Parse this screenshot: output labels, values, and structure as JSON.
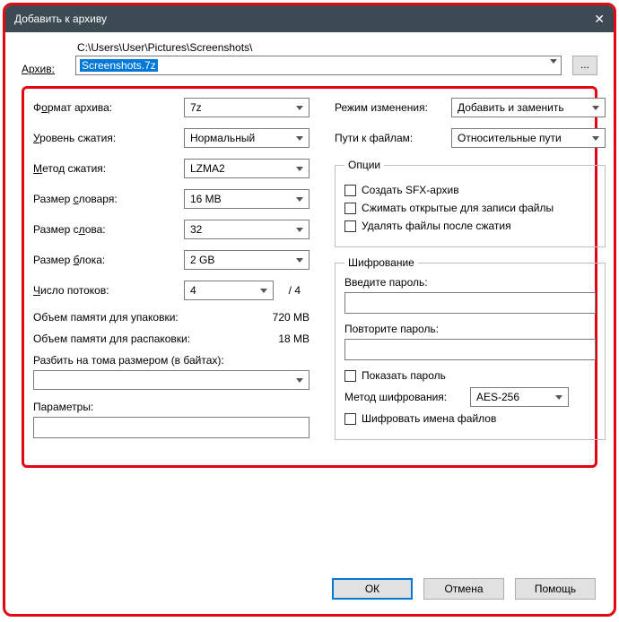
{
  "title": "Добавить к архиву",
  "archive": {
    "label": "Архив:",
    "path": "C:\\Users\\User\\Pictures\\Screenshots\\",
    "filename": "Screenshots.7z",
    "browse": "..."
  },
  "left": {
    "format": {
      "label_pre": "Ф",
      "label_u": "о",
      "label_post": "рмат архива:",
      "value": "7z"
    },
    "level": {
      "label_pre": "",
      "label_u": "У",
      "label_post": "ровень сжатия:",
      "value": "Нормальный"
    },
    "method": {
      "label_pre": "",
      "label_u": "М",
      "label_post": "етод сжатия:",
      "value": "LZMA2"
    },
    "dict": {
      "label_pre": "Размер ",
      "label_u": "с",
      "label_post": "ловаря:",
      "value": "16 MB"
    },
    "word": {
      "label_pre": "Размер с",
      "label_u": "л",
      "label_post": "ова:",
      "value": "32"
    },
    "block": {
      "label_pre": "Размер ",
      "label_u": "б",
      "label_post": "лока:",
      "value": "2 GB"
    },
    "threads": {
      "label_pre": "",
      "label_u": "Ч",
      "label_post": "исло потоков:",
      "value": "4",
      "max": "/ 4"
    },
    "mem_pack": {
      "label": "Объем памяти для упаковки:",
      "value": "720 MB"
    },
    "mem_unpack": {
      "label": "Объем памяти для распаковки:",
      "value": "18 MB"
    },
    "split": {
      "label_pre": "Разбить на ",
      "label_u": "т",
      "label_post": "ома размером (в байтах):"
    },
    "params": {
      "label_pre": "",
      "label_u": "П",
      "label_post": "араметры:"
    }
  },
  "right": {
    "mode": {
      "label": "Режим изменения:",
      "value": "Добавить и заменить"
    },
    "paths": {
      "label": "Пути к файлам:",
      "value": "Относительные пути"
    },
    "options": {
      "legend": "Опции",
      "sfx": "Создать SFX-архив",
      "open": "Сжимать открытые для записи файлы",
      "delete": "Удалять файлы после сжатия"
    },
    "encryption": {
      "legend": "Шифрование",
      "pw1": "Введите пароль:",
      "pw2": "Повторите пароль:",
      "show": "Показать пароль",
      "method_label": "Метод шифрования:",
      "method_value": "AES-256",
      "names": "Шифровать имена файлов"
    }
  },
  "buttons": {
    "ok": "ОК",
    "cancel": "Отмена",
    "help": "Помощь"
  }
}
